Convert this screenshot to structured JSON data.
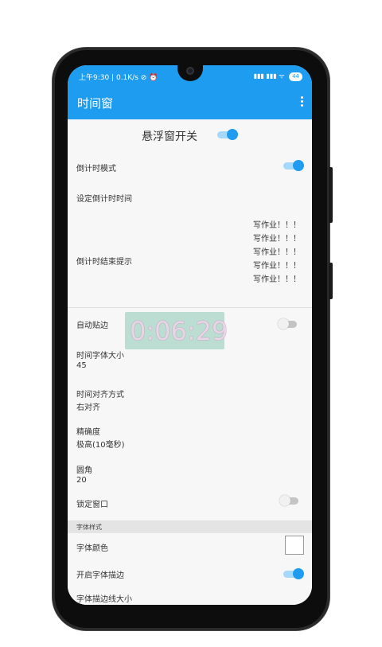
{
  "statusbar": {
    "left": "上午9:30 | 0.1K/s ⊘ ⏰",
    "right": "▮▮▮ ▮▮▮ ᯤ",
    "battery": "44"
  },
  "appbar": {
    "title": "时间窗"
  },
  "main": {
    "float_toggle_label": "悬浮窗开关",
    "float_toggle_on": true,
    "countdown_mode_label": "倒计时模式",
    "countdown_mode_on": true,
    "set_countdown_label": "设定倒计时时间",
    "countdown_end_hint_label": "倒计时结束提示",
    "countdown_end_hint_lines": [
      "写作业！！！",
      "写作业！！！",
      "写作业！！！",
      "写作业！！！",
      "写作业！！！"
    ],
    "auto_snap_label": "自动贴边",
    "auto_snap_on": false,
    "font_size_label": "时间字体大小",
    "font_size_value": "45",
    "align_label": "时间对齐方式",
    "align_value": "右对齐",
    "precision_label": "精确度",
    "precision_value": "极高(10毫秒)",
    "radius_label": "圆角",
    "radius_value": "20",
    "lock_window_label": "锁定窗口",
    "lock_window_on": false,
    "font_style_section": "字体样式",
    "font_color_label": "字体颜色",
    "font_color_value": "#ffffff",
    "stroke_label": "开启字体描边",
    "stroke_on": true,
    "stroke_size_label": "字体描边线大小"
  },
  "floating_window": {
    "time": "0:06:29"
  },
  "colors": {
    "accent": "#1e9cef"
  }
}
